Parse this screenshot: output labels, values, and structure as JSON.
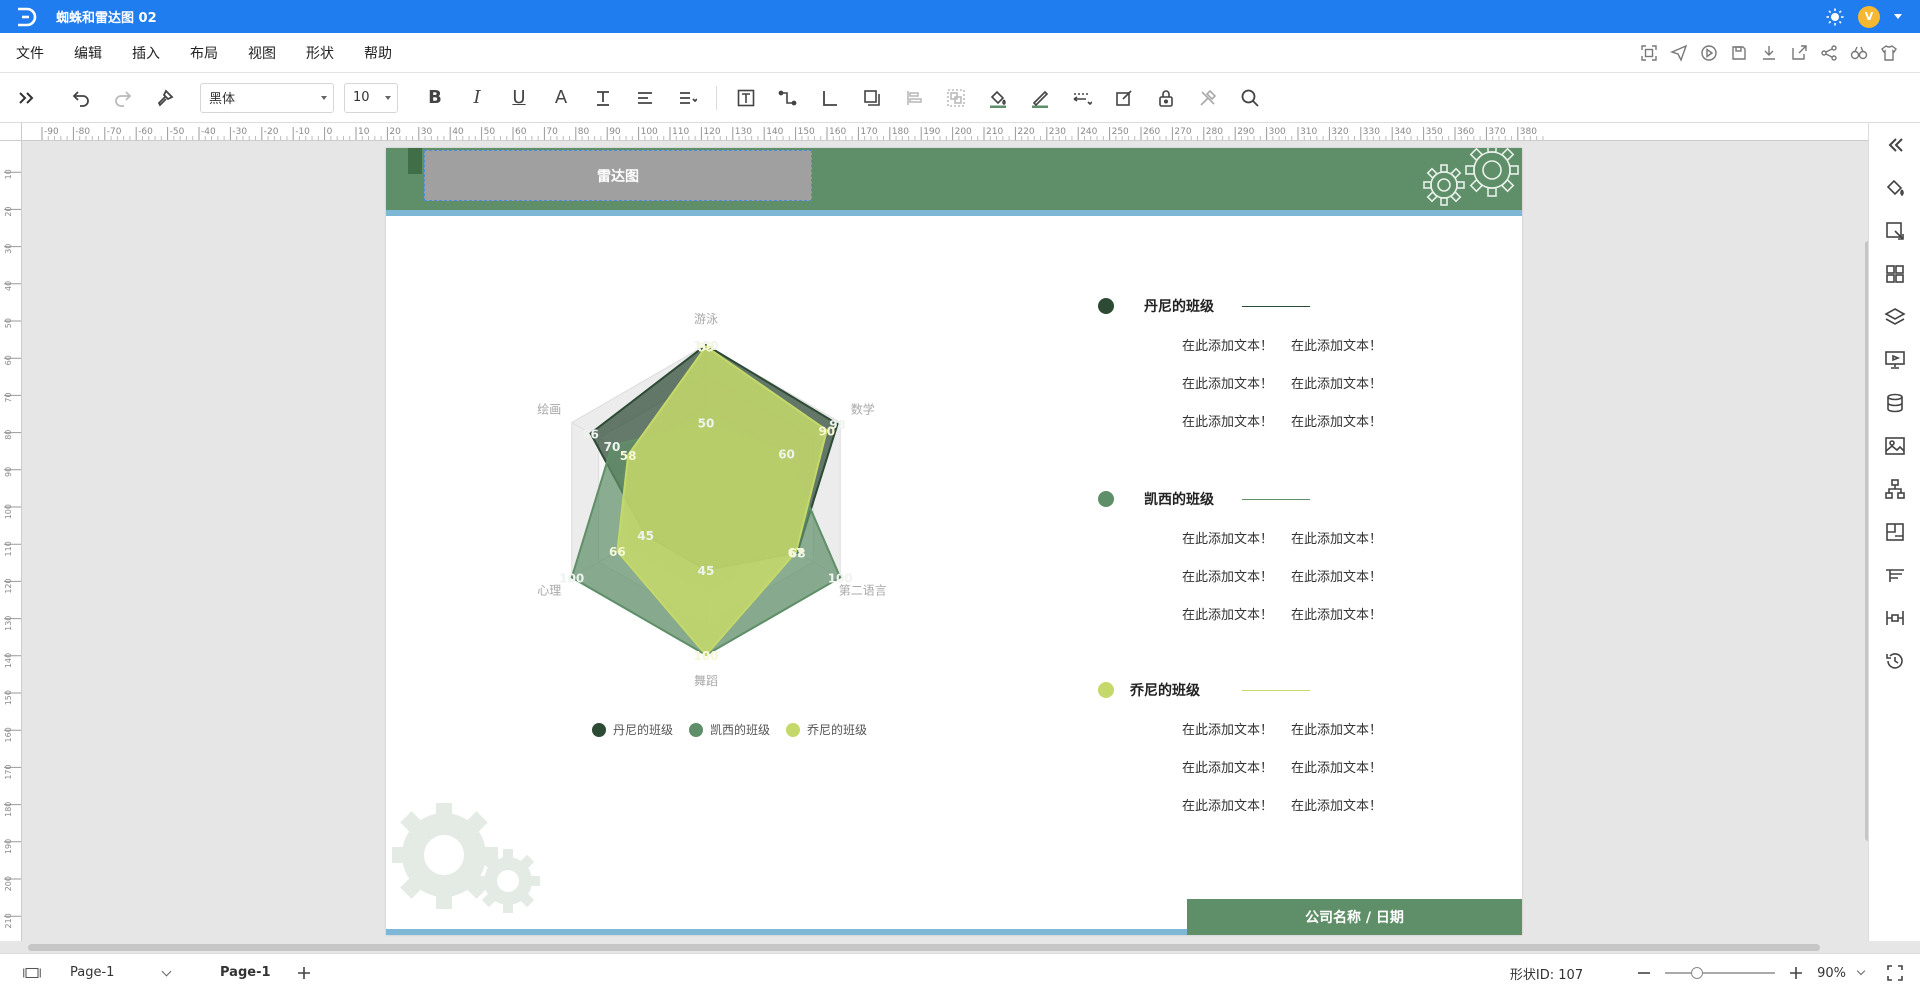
{
  "app": {
    "title": "蜘蛛和雷达图 02"
  },
  "menu": {
    "items": [
      "文件",
      "编辑",
      "插入",
      "布局",
      "视图",
      "形状",
      "帮助"
    ]
  },
  "toolbar": {
    "font_family": "黑体",
    "font_size": "10"
  },
  "ruler": {
    "top_ticks": [
      "-90",
      "-80",
      "-70",
      "-60",
      "-50",
      "-40",
      "-30",
      "-20",
      "-10",
      "0",
      "10",
      "20",
      "30",
      "40",
      "50",
      "60",
      "70",
      "80",
      "90",
      "100",
      "110",
      "120",
      "130",
      "140",
      "150",
      "160",
      "170",
      "180",
      "190",
      "200",
      "210",
      "220",
      "230",
      "240",
      "250",
      "260",
      "270",
      "280",
      "290",
      "300",
      "310",
      "320",
      "330",
      "340",
      "350",
      "360",
      "370",
      "380"
    ],
    "left_ticks": [
      "10",
      "20",
      "30",
      "40",
      "50",
      "60",
      "70",
      "80",
      "90",
      "100",
      "110",
      "120",
      "130",
      "140",
      "150",
      "160",
      "170",
      "180",
      "190",
      "200",
      "210"
    ]
  },
  "document": {
    "title_box": "雷达图",
    "footer": "公司名称 / 日期",
    "classes": [
      {
        "name": "丹尼的班级",
        "color": "#2d4a35",
        "rows": [
          [
            "在此添加文本！",
            "在此添加文本！"
          ],
          [
            "在此添加文本！",
            "在此添加文本！"
          ],
          [
            "在此添加文本！",
            "在此添加文本！"
          ]
        ]
      },
      {
        "name": "凯西的班级",
        "color": "#5f8f68",
        "rows": [
          [
            "在此添加文本！",
            "在此添加文本！"
          ],
          [
            "在此添加文本！",
            "在此添加文本！"
          ],
          [
            "在此添加文本！",
            "在此添加文本！"
          ]
        ]
      },
      {
        "name": "乔尼的班级",
        "color": "#c5d96a",
        "rows": [
          [
            "在此添加文本！",
            "在此添加文本！"
          ],
          [
            "在此添加文本！",
            "在此添加文本！"
          ],
          [
            "在此添加文本！",
            "在此添加文本！"
          ]
        ]
      }
    ]
  },
  "chart_data": {
    "type": "radar",
    "axes": [
      "游泳",
      "数学",
      "第二语言",
      "舞蹈",
      "心理",
      "绘画"
    ],
    "max": 100,
    "series": [
      {
        "name": "丹尼的班级",
        "color": "#2d4a35",
        "values": [
          100,
          98,
          68,
          45,
          45,
          86
        ]
      },
      {
        "name": "凯西的班级",
        "color": "#5f8f68",
        "values": [
          50,
          60,
          100,
          100,
          100,
          70
        ]
      },
      {
        "name": "乔尼的班级",
        "color": "#c5d96a",
        "values": [
          99,
          90,
          67,
          100,
          66,
          58
        ]
      }
    ]
  },
  "status": {
    "page_selector": "Page-1",
    "page_tab": "Page-1",
    "shape_id": "形状ID: 107",
    "zoom": "90%"
  }
}
